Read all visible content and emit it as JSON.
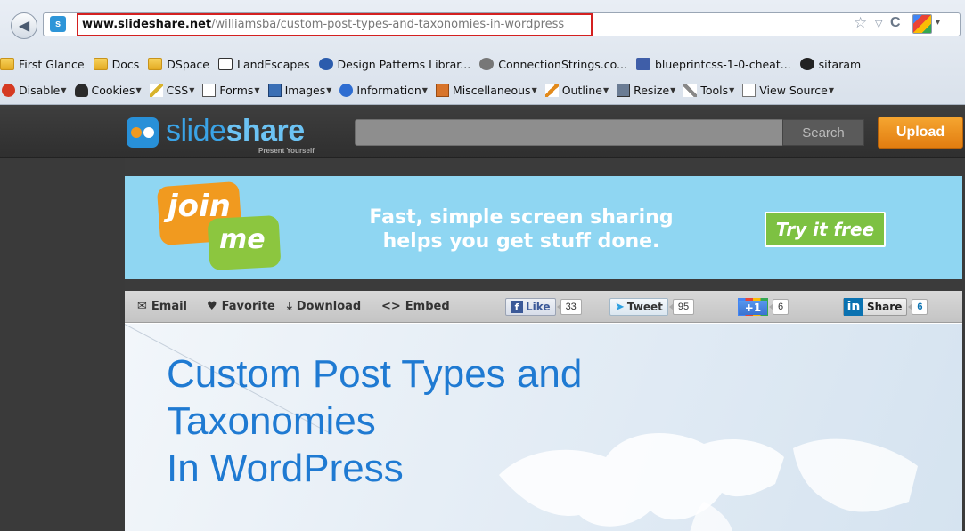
{
  "browser": {
    "url_domain": "www.slideshare.net",
    "url_path": "/williamsba/custom-post-types-and-taxonomies-in-wordpress",
    "url_prefix_hidden": "",
    "bookmarks": [
      {
        "label": "First Glance",
        "icon": "folder-icon"
      },
      {
        "label": "Docs",
        "icon": "folder-icon"
      },
      {
        "label": "DSpace",
        "icon": "folder-icon"
      },
      {
        "label": "LandEscapes",
        "icon": "dspace-icon"
      },
      {
        "label": "Design Patterns Librar...",
        "icon": "design-patterns-icon"
      },
      {
        "label": "ConnectionStrings.co...",
        "icon": "connectionstrings-icon"
      },
      {
        "label": "blueprintcss-1-0-cheat...",
        "icon": "gj-icon"
      },
      {
        "label": "sitaram",
        "icon": "github-icon"
      }
    ],
    "devtools": [
      {
        "label": "Disable",
        "icon": "disable-icon"
      },
      {
        "label": "Cookies",
        "icon": "cookies-icon"
      },
      {
        "label": "CSS",
        "icon": "css-icon"
      },
      {
        "label": "Forms",
        "icon": "forms-icon"
      },
      {
        "label": "Images",
        "icon": "images-icon"
      },
      {
        "label": "Information",
        "icon": "information-icon"
      },
      {
        "label": "Miscellaneous",
        "icon": "miscellaneous-icon"
      },
      {
        "label": "Outline",
        "icon": "outline-icon"
      },
      {
        "label": "Resize",
        "icon": "resize-icon"
      },
      {
        "label": "Tools",
        "icon": "tools-icon"
      },
      {
        "label": "View Source",
        "icon": "view-source-icon"
      }
    ]
  },
  "slideshare": {
    "logo_prefix": "slide",
    "logo_suffix": "share",
    "tagline": "Present Yourself",
    "search_label": "Search",
    "upload_label": "Upload"
  },
  "ad": {
    "join": "join",
    "me": "me",
    "headline_line1": "Fast, simple screen sharing",
    "headline_line2": "helps you get stuff done.",
    "cta": "Try it free"
  },
  "actions": {
    "email": "Email",
    "favorite": "Favorite",
    "download": "Download",
    "embed": "Embed"
  },
  "social": {
    "fb_label": "Like",
    "fb_count": "33",
    "tweet_label": "Tweet",
    "tweet_count": "95",
    "gplus_label": "+1",
    "gplus_count": "6",
    "li_label": "Share",
    "li_count": "6"
  },
  "slide": {
    "title_line1": "Custom Post Types and",
    "title_line2": "Taxonomies",
    "title_line3": "In WordPress"
  }
}
